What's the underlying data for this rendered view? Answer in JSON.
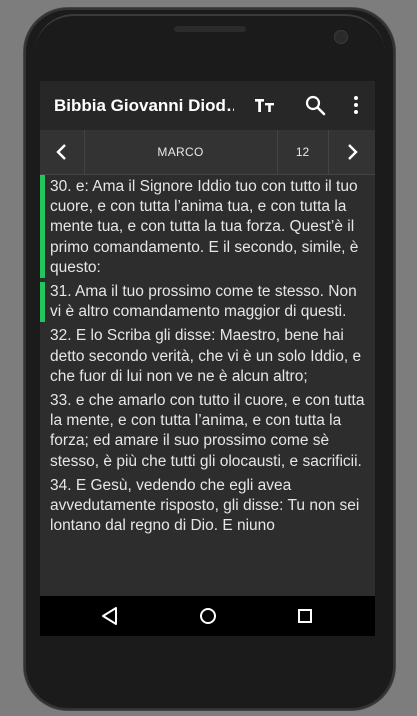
{
  "app": {
    "title": "Bibbia Giovanni Diod…"
  },
  "toolbar": {
    "font_icon": "text-size-icon",
    "search_icon": "search-icon",
    "menu_icon": "more-vert-icon"
  },
  "nav": {
    "book": "MARCO",
    "chapter": "12",
    "prev_icon": "chevron-left-icon",
    "next_icon": "chevron-right-icon"
  },
  "verses": [
    {
      "text": "30. e: Ama il Signore Iddio tuo con tutto il tuo cuore, e con tutta l’anima tua, e con tutta la mente tua, e con tutta la tua forza. Quest’è il primo comandamento. E il secondo, simile, è questo:",
      "highlighted": true
    },
    {
      "text": "31. Ama il tuo prossimo come te stesso. Non vi è altro comandamento maggior di questi.",
      "highlighted": true
    },
    {
      "text": "32. E lo Scriba gli disse: Maestro, bene hai detto secondo verità, che vi è un solo Iddio, e che fuor di lui non ve ne è alcun altro;",
      "highlighted": false
    },
    {
      "text": "33. e che amarlo con tutto il cuore, e con tutta la mente, e con tutta l’anima, e con tutta la forza; ed amare il suo prossimo come sè stesso, è più che tutti gli olocausti, e sacrificii.",
      "highlighted": false
    },
    {
      "text": "34. E Gesù, vedendo che egli avea avvedutamente risposto, gli disse: Tu non sei lontano dal regno di Dio. E niuno",
      "highlighted": false
    }
  ],
  "system_nav": {
    "back_icon": "back-triangle-icon",
    "home_icon": "home-circle-icon",
    "recents_icon": "recents-square-icon"
  },
  "colors": {
    "highlight": "#22c55e",
    "background": "#2d2d2d",
    "appbar": "#272727"
  }
}
